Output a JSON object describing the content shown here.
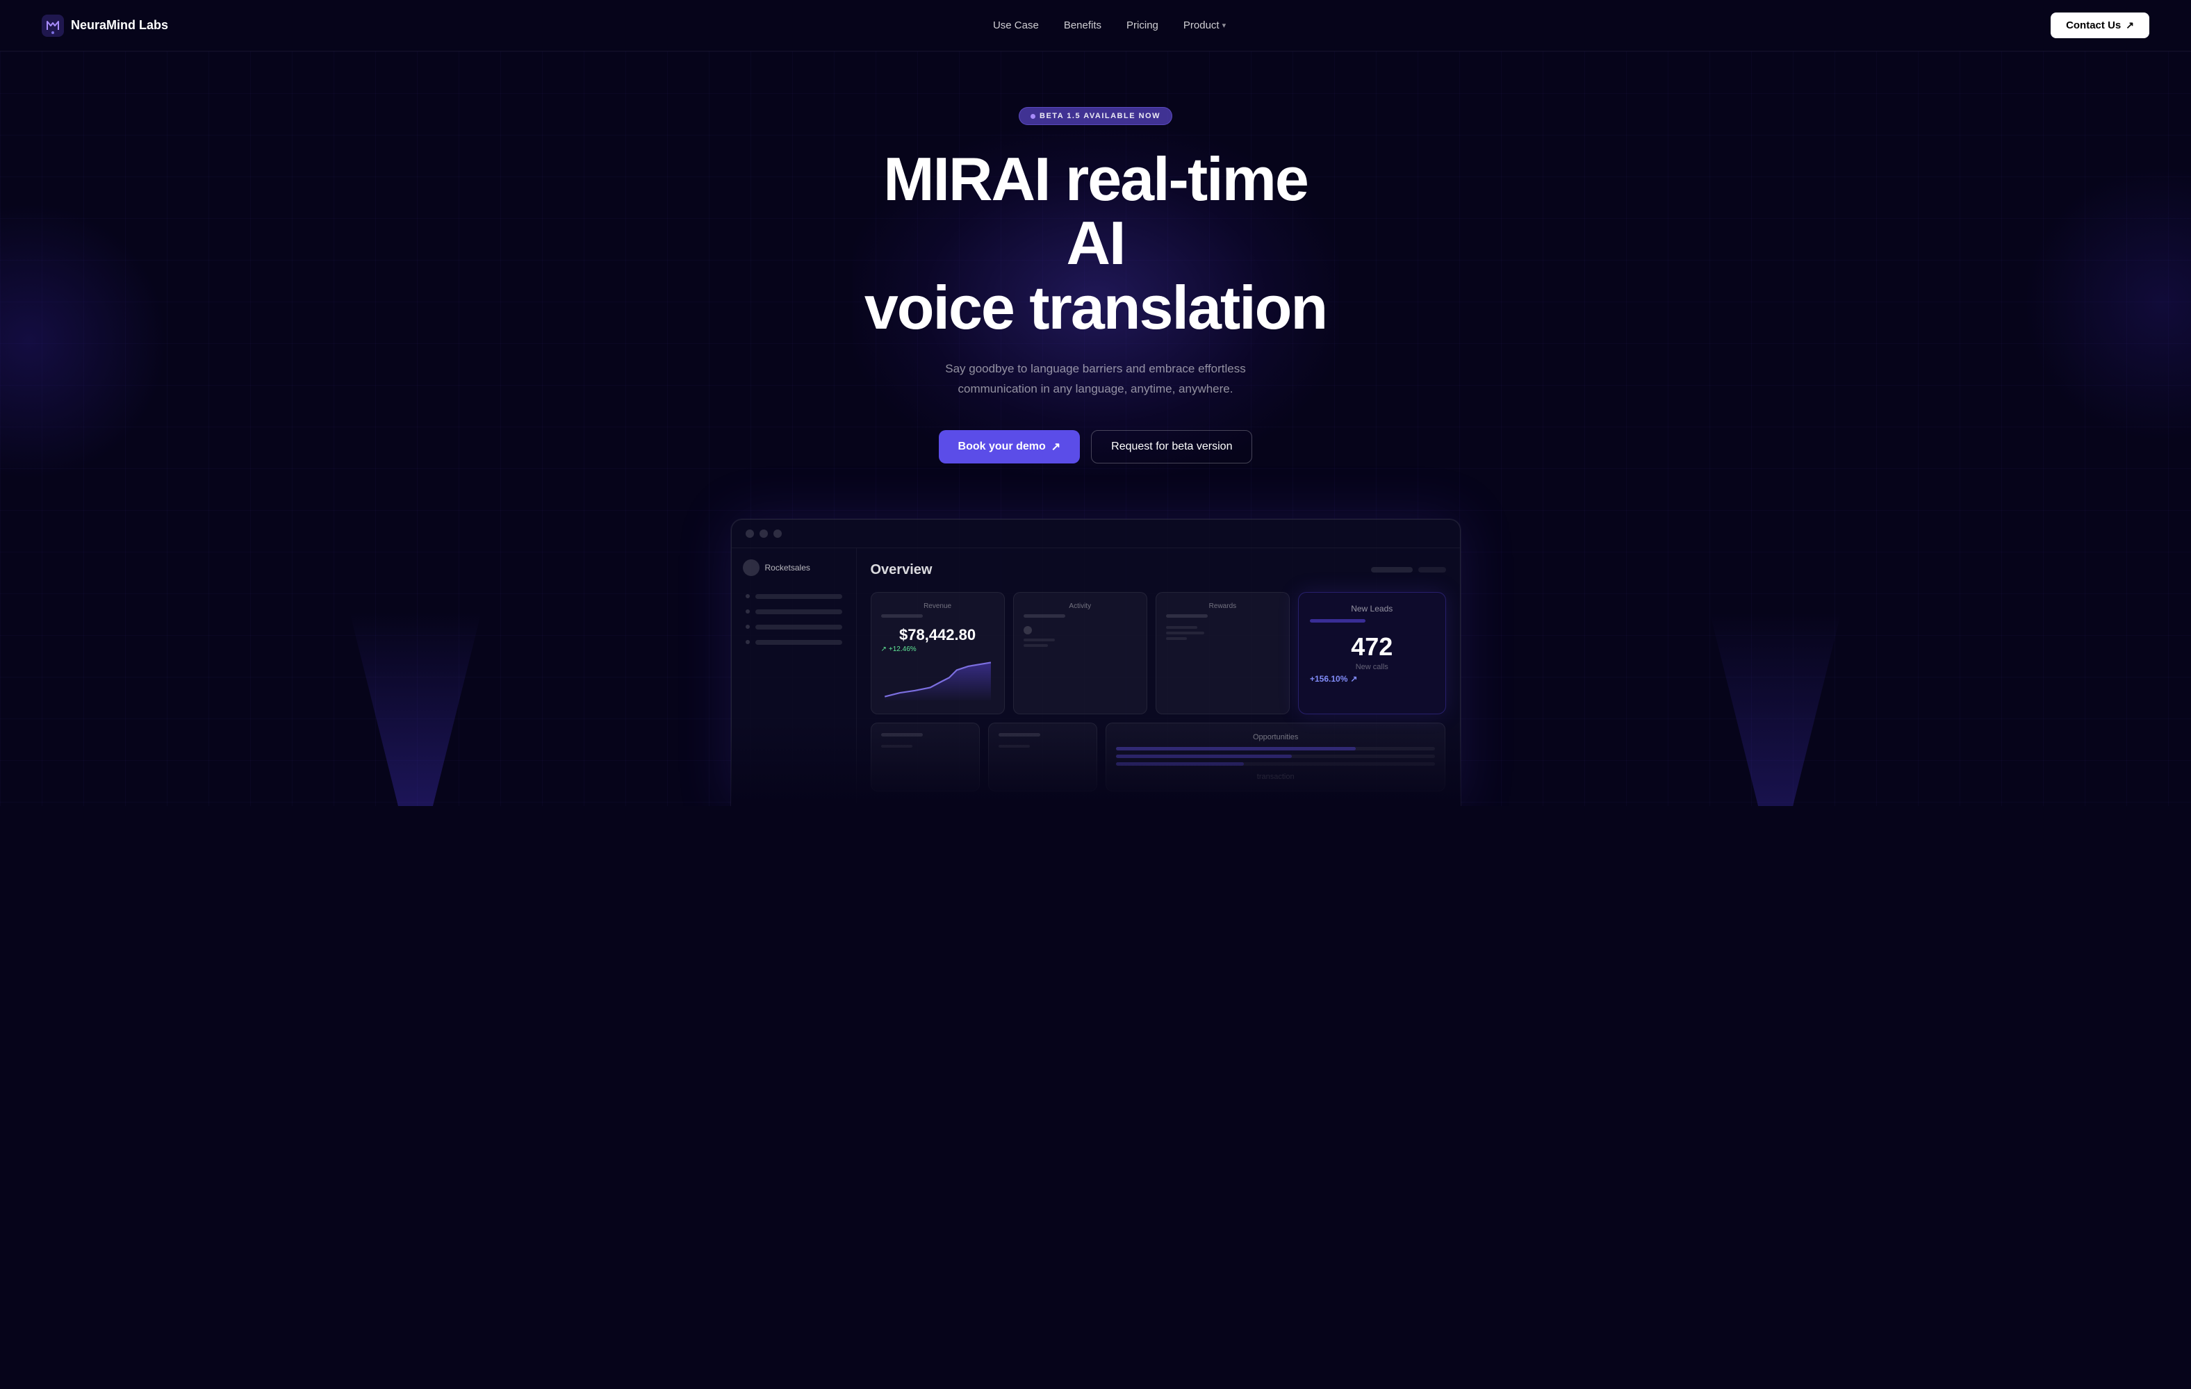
{
  "nav": {
    "logo_text": "NeuraMind Labs",
    "links": [
      {
        "label": "Use Case",
        "id": "use-case"
      },
      {
        "label": "Benefits",
        "id": "benefits"
      },
      {
        "label": "Pricing",
        "id": "pricing"
      },
      {
        "label": "Product",
        "id": "product",
        "hasDropdown": true
      }
    ],
    "cta_label": "Contact Us"
  },
  "hero": {
    "badge_text": "BETA 1.5 AVAILABLE NOW",
    "title_line1": "MIRAI real-time AI",
    "title_line2": "voice translation",
    "subtitle": "Say goodbye to language barriers and embrace effortless communication in any language, anytime, anywhere.",
    "btn_primary": "Book your demo",
    "btn_secondary": "Request for beta version"
  },
  "dashboard": {
    "window_title": "Rocketsales",
    "overview_title": "Overview",
    "cards": [
      {
        "label": "Revenue",
        "value": "$78,442.80",
        "change": "+12.46%",
        "positive": true,
        "has_chart": true
      },
      {
        "label": "Activity",
        "value": "",
        "change": "",
        "positive": true,
        "has_chart": false
      },
      {
        "label": "Rewards",
        "value": "",
        "change": "",
        "positive": true,
        "has_chart": false
      }
    ],
    "opportunities_label": "Opportunities",
    "new_leads": {
      "label": "New Leads",
      "value": "472",
      "sub_label": "New calls",
      "change": "+156.10%"
    }
  }
}
